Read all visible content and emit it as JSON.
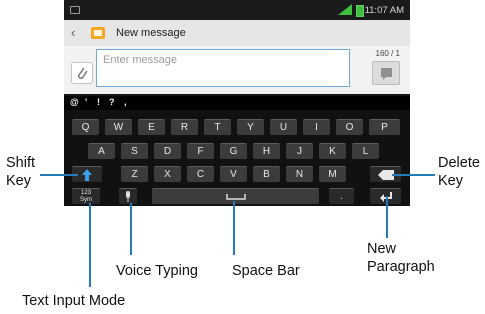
{
  "statusbar": {
    "time": "11:07 AM"
  },
  "titlebar": {
    "title": "New message"
  },
  "composer": {
    "placeholder": "Enter message",
    "counter": "160 / 1"
  },
  "keyboard": {
    "symbols": [
      "@",
      "'",
      "!",
      "?",
      ","
    ],
    "row1": [
      "Q",
      "W",
      "E",
      "R",
      "T",
      "Y",
      "U",
      "I",
      "O",
      "P"
    ],
    "row2": [
      "A",
      "S",
      "D",
      "F",
      "G",
      "H",
      "J",
      "K",
      "L"
    ],
    "row3": [
      "Z",
      "X",
      "C",
      "V",
      "B",
      "N",
      "M"
    ],
    "mode_key": "123\nSym",
    "period_key": "."
  },
  "callouts": {
    "shift_key": "Shift\nKey",
    "delete_key": "Delete\nKey",
    "new_paragraph": "New\nParagraph",
    "voice_typing": "Voice Typing",
    "space_bar": "Space Bar",
    "text_input_mode": "Text Input Mode"
  },
  "colors": {
    "callout_line": "#2779b8",
    "shift_arrow": "#3aa0e8"
  },
  "icons": {
    "back": "back-arrow-icon",
    "app": "messaging-app-icon",
    "attach": "paperclip-icon",
    "send": "send-icon",
    "shift": "shift-arrow-icon",
    "delete": "backspace-icon",
    "mic": "microphone-icon",
    "space": "space-icon",
    "enter": "enter-icon"
  }
}
